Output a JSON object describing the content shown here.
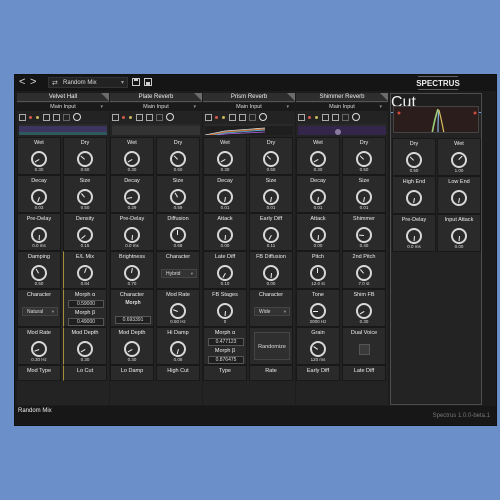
{
  "topbar": {
    "back": "<",
    "forward": ">",
    "preset": "Random Mix",
    "logo": "SPECTRUS"
  },
  "columns": [
    {
      "title": "Velvet Hall",
      "input": "Main Input",
      "cells": [
        {
          "label": "Wet",
          "value": "0.30",
          "angle": -120
        },
        {
          "label": "Dry",
          "value": "0.50",
          "angle": -50
        },
        {
          "label": "Decay",
          "value": "0.03",
          "angle": -160
        },
        {
          "label": "Size",
          "value": "0.50",
          "angle": -40
        },
        {
          "label": "Pre-Delay",
          "value": "0.0 ms",
          "angle": -175
        },
        {
          "label": "Density",
          "value": "0.15",
          "angle": -130
        },
        {
          "label": "Damping",
          "value": "0.50",
          "angle": -30
        },
        {
          "label": "E/L Mix",
          "value": "0.84",
          "angle": 20
        },
        {
          "label": "Character",
          "value": "Natural",
          "kind": "select"
        },
        {
          "label": "Morph α",
          "value": "0.59000",
          "kind": "stack",
          "label2": "Morph β",
          "value2": "0.49000"
        },
        {
          "label": "Mod Rate",
          "value": "0.30 Hz",
          "angle": -110
        },
        {
          "label": "Mod Depth",
          "value": "0.30",
          "angle": -120
        },
        {
          "label": "Mod Type",
          "value": "",
          "angle": -120
        },
        {
          "label": "Lo Cut",
          "value": "",
          "angle": -120
        }
      ]
    },
    {
      "title": "Plate Reverb",
      "input": "Main Input",
      "cells": [
        {
          "label": "Wet",
          "value": "0.30",
          "angle": -120
        },
        {
          "label": "Dry",
          "value": "0.50",
          "angle": -45
        },
        {
          "label": "Decay",
          "value": "0.29",
          "angle": -100
        },
        {
          "label": "Size",
          "value": "0.59",
          "angle": -30
        },
        {
          "label": "Pre-Delay",
          "value": "0.0 ms",
          "angle": -175
        },
        {
          "label": "Diffusion",
          "value": "0.68",
          "angle": 0
        },
        {
          "label": "Brightness",
          "value": "0.70",
          "angle": 10
        },
        {
          "label": "Character",
          "value": "Hybrid",
          "kind": "select"
        },
        {
          "label": "Character",
          "value": "0.693391",
          "kind": "button",
          "button": "Morph"
        },
        {
          "label": "Mod Rate",
          "value": "0.50 Hz",
          "angle": -70
        },
        {
          "label": "Mod Depth",
          "value": "0.30",
          "angle": -120
        },
        {
          "label": "Hi Damp",
          "value": "0.08",
          "angle": -165
        },
        {
          "label": "Lo Damp",
          "value": "",
          "angle": -120
        },
        {
          "label": "High Cut",
          "value": "",
          "angle": -120
        }
      ]
    },
    {
      "title": "Prism Reverb",
      "input": "Main Input",
      "cells": [
        {
          "label": "Wet",
          "value": "0.30",
          "angle": -120
        },
        {
          "label": "Dry",
          "value": "0.50",
          "angle": -45
        },
        {
          "label": "Decay",
          "value": "0.01",
          "angle": -170
        },
        {
          "label": "Size",
          "value": "0.01",
          "angle": -170
        },
        {
          "label": "Attack",
          "value": "0.00",
          "angle": -175
        },
        {
          "label": "Early Diff",
          "value": "0.11",
          "angle": -150
        },
        {
          "label": "Late Diff",
          "value": "0.10",
          "angle": -150
        },
        {
          "label": "FB Diffusion",
          "value": "0.00",
          "angle": -175
        },
        {
          "label": "FB Stages",
          "value": "0",
          "angle": -175
        },
        {
          "label": "Character",
          "value": "Wide",
          "kind": "select"
        },
        {
          "label": "Morph α",
          "value": "0.477123",
          "kind": "stack",
          "label2": "Morph β",
          "value2": "0.876475"
        },
        {
          "label": "Randomize",
          "value": "",
          "kind": "button2"
        },
        {
          "label": "Type",
          "value": "",
          "angle": -120
        },
        {
          "label": "Rate",
          "value": "",
          "angle": -120
        }
      ]
    },
    {
      "title": "Shimmer Reverb",
      "input": "Main Input",
      "cells": [
        {
          "label": "Wet",
          "value": "0.30",
          "angle": -120
        },
        {
          "label": "Dry",
          "value": "0.50",
          "angle": -45
        },
        {
          "label": "Decay",
          "value": "0.01",
          "angle": -170
        },
        {
          "label": "Size",
          "value": "0.01",
          "angle": -170
        },
        {
          "label": "Attack",
          "value": "0.00",
          "angle": -175
        },
        {
          "label": "Shimmer",
          "value": "0.40",
          "angle": -85
        },
        {
          "label": "Pitch",
          "value": "12.0 st",
          "angle": 0
        },
        {
          "label": "2nd Pitch",
          "value": "7.0 st",
          "angle": -40
        },
        {
          "label": "Tone",
          "value": "2000 Hz",
          "angle": -90
        },
        {
          "label": "Shim FB",
          "value": "0.30",
          "angle": -120
        },
        {
          "label": "Grain",
          "value": "120 ms",
          "angle": -55
        },
        {
          "label": "Dual Voice",
          "value": "",
          "kind": "square"
        },
        {
          "label": "Early Diff",
          "value": "",
          "angle": -120
        },
        {
          "label": "Late Diff",
          "value": "",
          "angle": -120
        }
      ]
    }
  ],
  "cut": {
    "title": "Cut",
    "cells": [
      {
        "label": "Dry",
        "value": "0.50",
        "angle": -45
      },
      {
        "label": "Wet",
        "value": "1.00",
        "angle": 45
      },
      {
        "label": "High End",
        "value": "",
        "angle": -170
      },
      {
        "label": "Low End",
        "value": "",
        "angle": -170
      },
      {
        "label": "Pre-Delay",
        "value": "0.0 ms",
        "angle": -175
      },
      {
        "label": "Input Attack",
        "value": "0.00",
        "angle": -175
      }
    ]
  },
  "bottom": {
    "name": "Random Mix",
    "version": "Spectrus 1.0.0-beta.1"
  },
  "colors": {
    "background": "#6b8fc9",
    "panel": "#1c1c1c",
    "accent_blue": "#6e9de8",
    "accent_gold": "#a58f38"
  }
}
